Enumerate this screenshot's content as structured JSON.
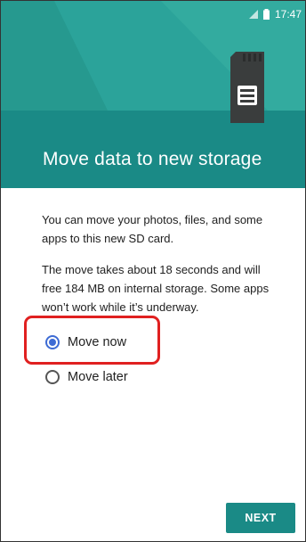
{
  "status_bar": {
    "time": "17:47",
    "icons": [
      "signal-icon",
      "battery-icon"
    ]
  },
  "header": {
    "title": "Move data to new storage",
    "illustration_icon": "sd-card-icon"
  },
  "content": {
    "paragraph_1": "You can move your photos, files, and some apps to this new SD card.",
    "paragraph_2": "The move takes about 18 seconds and will free 184 MB on internal storage. Some apps won’t work while it’s underway."
  },
  "options": [
    {
      "label": "Move now",
      "selected": true
    },
    {
      "label": "Move later",
      "selected": false
    }
  ],
  "footer": {
    "next_label": "NEXT"
  },
  "colors": {
    "header_dark": "#1a8a86",
    "header_light": "#2ba39a",
    "radio_accent": "#3d6bd4",
    "highlight": "#e02020"
  }
}
